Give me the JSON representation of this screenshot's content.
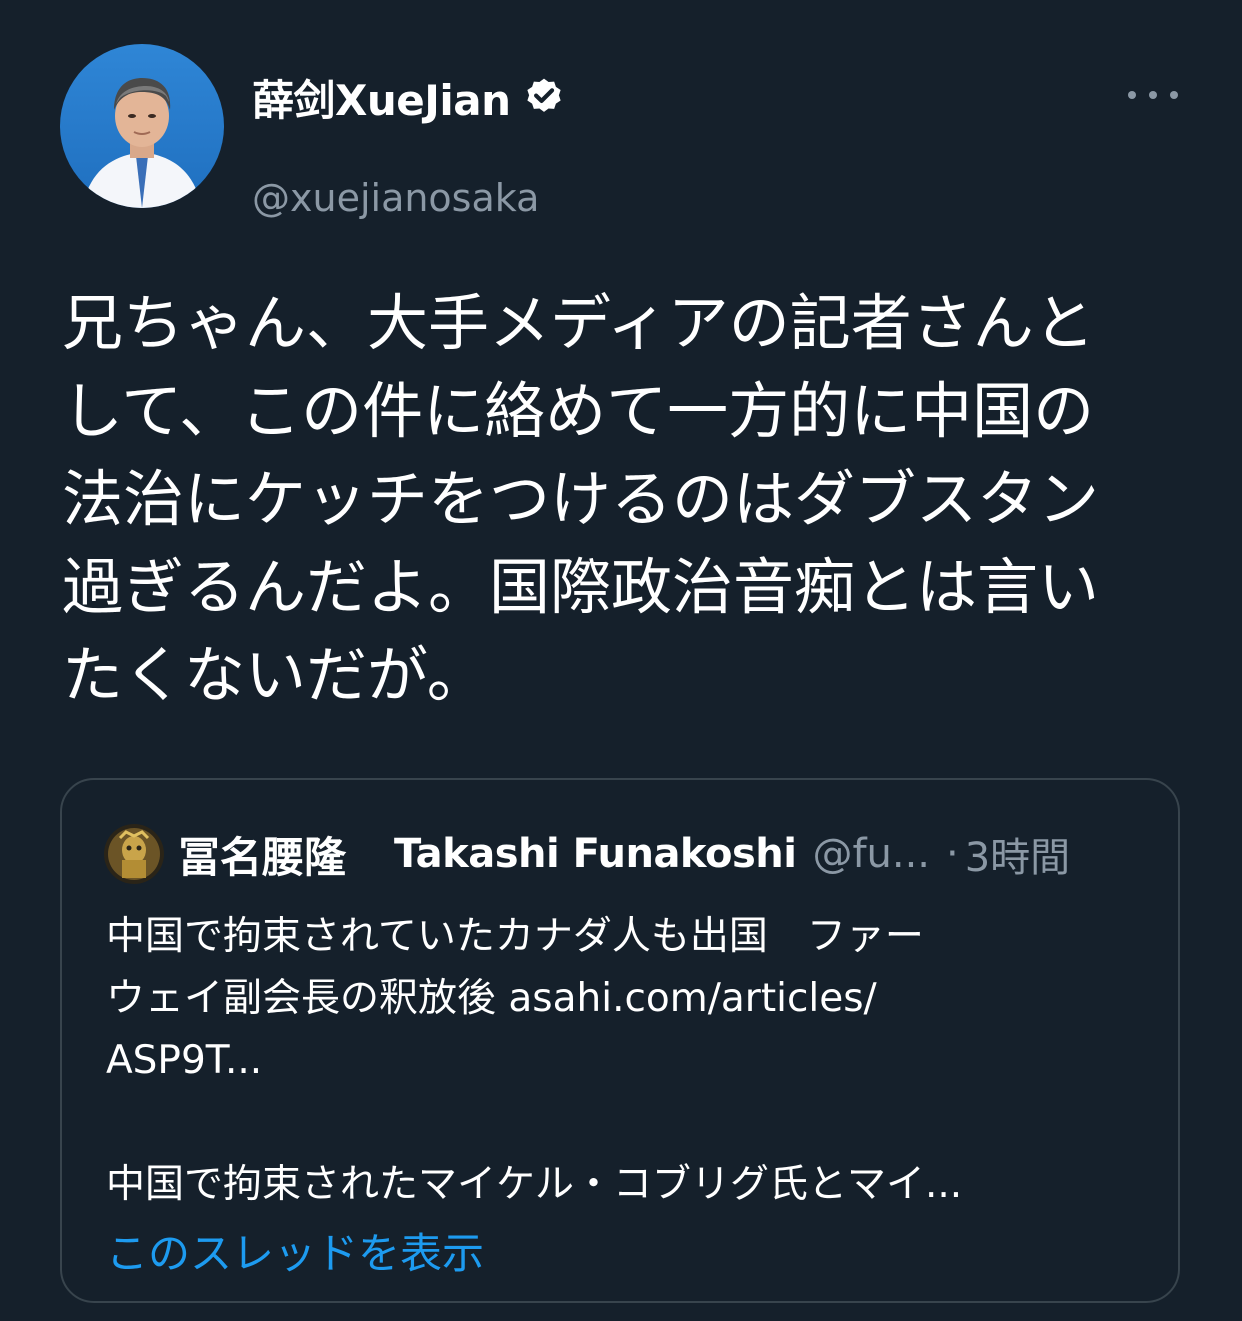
{
  "author": {
    "name": "薛剑XueJian",
    "handle": "@xuejianosaka",
    "verified": true,
    "avatar_icon": "avatar-photo"
  },
  "more_icon": "more-horizontal-icon",
  "tweet": {
    "lines": [
      "兄ちゃん、大手メディアの記者さんと",
      "して、この件に絡めて一方的に中国の",
      "法治にケッチをつけるのはダブスタン",
      "過ぎるんだよ。国際政治音痴とは言い",
      "たくないだが。"
    ]
  },
  "quote": {
    "name_jp": "冨名腰隆",
    "name_en": "Takashi Funakoshi",
    "handle": "@fu...",
    "separator": "·",
    "time": "3時間",
    "body_lines": [
      "中国で拘束されていたカナダ人も出国　ファー",
      "ウェイ副会長の釈放後 asahi.com/articles/",
      "ASP9T..."
    ],
    "body_second": "中国で拘束されたマイケル・コブリグ氏とマイ...",
    "show_thread": "このスレッドを表示"
  },
  "colors": {
    "background": "#15202b",
    "text_primary": "#ffffff",
    "text_secondary": "#8b98a5",
    "link": "#1d9bf0",
    "border": "#38444d",
    "verified_badge": "#ffffff"
  }
}
